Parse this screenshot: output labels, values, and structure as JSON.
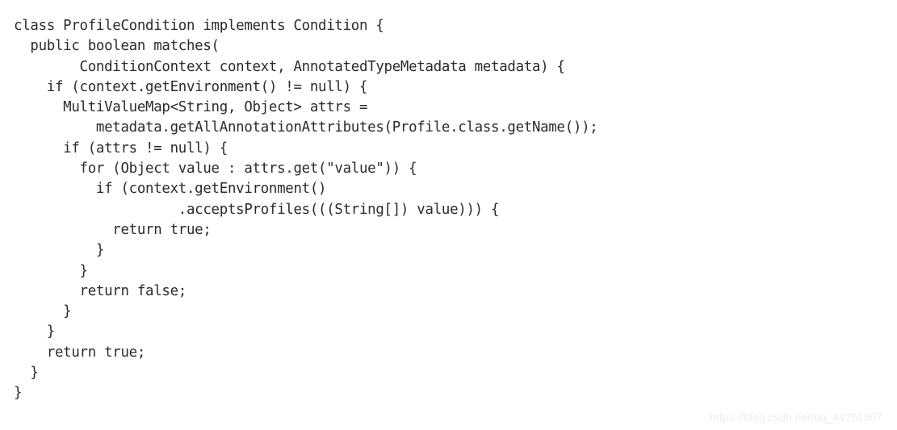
{
  "page": {
    "background_color": "#ffffff",
    "text_color": "#2b2b2b",
    "kind": "code-listing-image",
    "language": "Java"
  },
  "code": {
    "lines": [
      "class ProfileCondition implements Condition {",
      "  public boolean matches(",
      "        ConditionContext context, AnnotatedTypeMetadata metadata) {",
      "    if (context.getEnvironment() != null) {",
      "      MultiValueMap<String, Object> attrs =",
      "          metadata.getAllAnnotationAttributes(Profile.class.getName());",
      "      if (attrs != null) {",
      "        for (Object value : attrs.get(\"value\")) {",
      "          if (context.getEnvironment()",
      "                    .acceptsProfiles(((String[]) value))) {",
      "            return true;",
      "          }",
      "        }",
      "        return false;",
      "      }",
      "    }",
      "    return true;",
      "  }",
      "}"
    ]
  },
  "watermark": {
    "text": "https://blog.csdn.net/qq_44761507",
    "color": "#ededed"
  }
}
